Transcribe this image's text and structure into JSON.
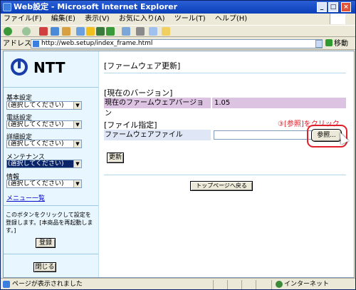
{
  "window": {
    "title": "Web設定 - Microsoft Internet Explorer",
    "controls": [
      "_",
      "□",
      "×"
    ]
  },
  "menubar": {
    "items": [
      "ファイル(F)",
      "編集(E)",
      "表示(V)",
      "お気に入り(A)",
      "ツール(T)",
      "ヘルプ(H)"
    ]
  },
  "toolbar": {
    "icons": [
      "back-icon",
      "forward-icon",
      "stop-icon",
      "refresh-icon",
      "home-icon",
      "search-icon",
      "favorites-icon",
      "media-icon",
      "history-icon",
      "mail-icon",
      "print-icon",
      "edit-icon",
      "folder-icon"
    ]
  },
  "address": {
    "label": "アドレス(D)",
    "url": "http://web.setup/index_frame.html",
    "go_label": "移動"
  },
  "sidebar": {
    "logo_text": "NTT",
    "sections": [
      {
        "label": "基本設定",
        "select": "(選択してください)"
      },
      {
        "label": "電話設定",
        "select": "(選択してください)"
      },
      {
        "label": "詳細設定",
        "select": "(選択してください)"
      },
      {
        "label": "メンテナンス",
        "select": "(選択してください)"
      },
      {
        "label": "情報",
        "select": "(選択してください)"
      }
    ],
    "menu_link": "メニュー一覧",
    "note": "このボタンをクリックして設定を登録します。[本商品を再起動します。]",
    "register_button": "登録",
    "close_button": "閉じる"
  },
  "main": {
    "page_title": "[ファームウェア更新]",
    "current_version_heading": "[現在のバージョン]",
    "current_version_label": "現在のファームウェアバージョン",
    "current_version_value": "1.05",
    "file_heading": "[ファイル指定]",
    "annotation": "③[参照]をクリック",
    "file_label": "ファームウェアファイル",
    "file_value": "",
    "browse_button": "参照...",
    "update_button": "更新",
    "top_button": "トップページへ戻る"
  },
  "status": {
    "message": "ページが表示されました",
    "zone": "インターネット"
  },
  "colors": {
    "version_row_bg": "#dcc3e2",
    "file_row_label_bg": "#dfe6f5",
    "sidebar_bg": "#e8f6ff",
    "annotation_red": "#e0202a"
  }
}
